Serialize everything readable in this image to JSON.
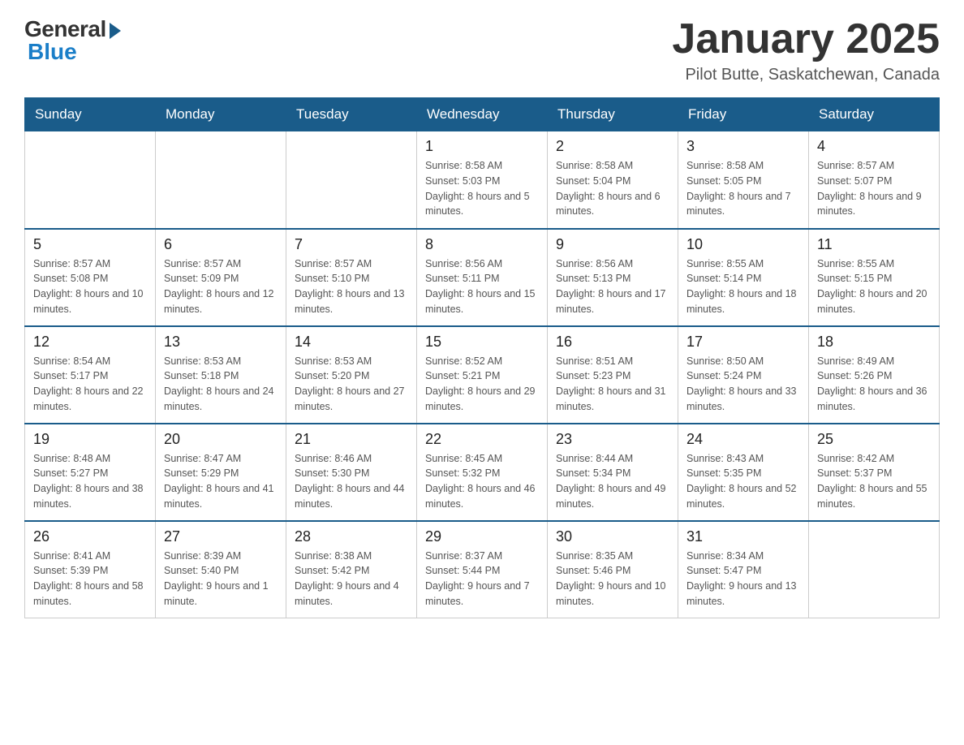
{
  "header": {
    "logo_general": "General",
    "logo_blue": "Blue",
    "title": "January 2025",
    "subtitle": "Pilot Butte, Saskatchewan, Canada"
  },
  "weekdays": [
    "Sunday",
    "Monday",
    "Tuesday",
    "Wednesday",
    "Thursday",
    "Friday",
    "Saturday"
  ],
  "weeks": [
    [
      {
        "day": "",
        "info": ""
      },
      {
        "day": "",
        "info": ""
      },
      {
        "day": "",
        "info": ""
      },
      {
        "day": "1",
        "info": "Sunrise: 8:58 AM\nSunset: 5:03 PM\nDaylight: 8 hours and 5 minutes."
      },
      {
        "day": "2",
        "info": "Sunrise: 8:58 AM\nSunset: 5:04 PM\nDaylight: 8 hours and 6 minutes."
      },
      {
        "day": "3",
        "info": "Sunrise: 8:58 AM\nSunset: 5:05 PM\nDaylight: 8 hours and 7 minutes."
      },
      {
        "day": "4",
        "info": "Sunrise: 8:57 AM\nSunset: 5:07 PM\nDaylight: 8 hours and 9 minutes."
      }
    ],
    [
      {
        "day": "5",
        "info": "Sunrise: 8:57 AM\nSunset: 5:08 PM\nDaylight: 8 hours and 10 minutes."
      },
      {
        "day": "6",
        "info": "Sunrise: 8:57 AM\nSunset: 5:09 PM\nDaylight: 8 hours and 12 minutes."
      },
      {
        "day": "7",
        "info": "Sunrise: 8:57 AM\nSunset: 5:10 PM\nDaylight: 8 hours and 13 minutes."
      },
      {
        "day": "8",
        "info": "Sunrise: 8:56 AM\nSunset: 5:11 PM\nDaylight: 8 hours and 15 minutes."
      },
      {
        "day": "9",
        "info": "Sunrise: 8:56 AM\nSunset: 5:13 PM\nDaylight: 8 hours and 17 minutes."
      },
      {
        "day": "10",
        "info": "Sunrise: 8:55 AM\nSunset: 5:14 PM\nDaylight: 8 hours and 18 minutes."
      },
      {
        "day": "11",
        "info": "Sunrise: 8:55 AM\nSunset: 5:15 PM\nDaylight: 8 hours and 20 minutes."
      }
    ],
    [
      {
        "day": "12",
        "info": "Sunrise: 8:54 AM\nSunset: 5:17 PM\nDaylight: 8 hours and 22 minutes."
      },
      {
        "day": "13",
        "info": "Sunrise: 8:53 AM\nSunset: 5:18 PM\nDaylight: 8 hours and 24 minutes."
      },
      {
        "day": "14",
        "info": "Sunrise: 8:53 AM\nSunset: 5:20 PM\nDaylight: 8 hours and 27 minutes."
      },
      {
        "day": "15",
        "info": "Sunrise: 8:52 AM\nSunset: 5:21 PM\nDaylight: 8 hours and 29 minutes."
      },
      {
        "day": "16",
        "info": "Sunrise: 8:51 AM\nSunset: 5:23 PM\nDaylight: 8 hours and 31 minutes."
      },
      {
        "day": "17",
        "info": "Sunrise: 8:50 AM\nSunset: 5:24 PM\nDaylight: 8 hours and 33 minutes."
      },
      {
        "day": "18",
        "info": "Sunrise: 8:49 AM\nSunset: 5:26 PM\nDaylight: 8 hours and 36 minutes."
      }
    ],
    [
      {
        "day": "19",
        "info": "Sunrise: 8:48 AM\nSunset: 5:27 PM\nDaylight: 8 hours and 38 minutes."
      },
      {
        "day": "20",
        "info": "Sunrise: 8:47 AM\nSunset: 5:29 PM\nDaylight: 8 hours and 41 minutes."
      },
      {
        "day": "21",
        "info": "Sunrise: 8:46 AM\nSunset: 5:30 PM\nDaylight: 8 hours and 44 minutes."
      },
      {
        "day": "22",
        "info": "Sunrise: 8:45 AM\nSunset: 5:32 PM\nDaylight: 8 hours and 46 minutes."
      },
      {
        "day": "23",
        "info": "Sunrise: 8:44 AM\nSunset: 5:34 PM\nDaylight: 8 hours and 49 minutes."
      },
      {
        "day": "24",
        "info": "Sunrise: 8:43 AM\nSunset: 5:35 PM\nDaylight: 8 hours and 52 minutes."
      },
      {
        "day": "25",
        "info": "Sunrise: 8:42 AM\nSunset: 5:37 PM\nDaylight: 8 hours and 55 minutes."
      }
    ],
    [
      {
        "day": "26",
        "info": "Sunrise: 8:41 AM\nSunset: 5:39 PM\nDaylight: 8 hours and 58 minutes."
      },
      {
        "day": "27",
        "info": "Sunrise: 8:39 AM\nSunset: 5:40 PM\nDaylight: 9 hours and 1 minute."
      },
      {
        "day": "28",
        "info": "Sunrise: 8:38 AM\nSunset: 5:42 PM\nDaylight: 9 hours and 4 minutes."
      },
      {
        "day": "29",
        "info": "Sunrise: 8:37 AM\nSunset: 5:44 PM\nDaylight: 9 hours and 7 minutes."
      },
      {
        "day": "30",
        "info": "Sunrise: 8:35 AM\nSunset: 5:46 PM\nDaylight: 9 hours and 10 minutes."
      },
      {
        "day": "31",
        "info": "Sunrise: 8:34 AM\nSunset: 5:47 PM\nDaylight: 9 hours and 13 minutes."
      },
      {
        "day": "",
        "info": ""
      }
    ]
  ]
}
